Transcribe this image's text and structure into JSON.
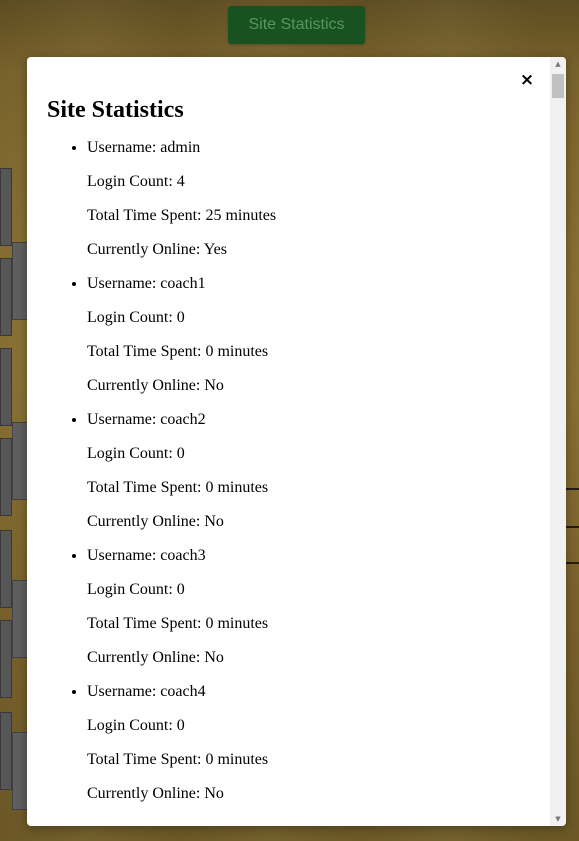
{
  "page": {
    "top_button_label": "Site Statistics"
  },
  "modal": {
    "title": "Site Statistics",
    "close_label": "×",
    "users": [
      {
        "username_line": "Username: admin",
        "login_count_line": "Login Count: 4",
        "time_spent_line": "Total Time Spent: 25 minutes",
        "online_line": "Currently Online: Yes"
      },
      {
        "username_line": "Username: coach1",
        "login_count_line": "Login Count: 0",
        "time_spent_line": "Total Time Spent: 0 minutes",
        "online_line": "Currently Online: No"
      },
      {
        "username_line": "Username: coach2",
        "login_count_line": "Login Count: 0",
        "time_spent_line": "Total Time Spent: 0 minutes",
        "online_line": "Currently Online: No"
      },
      {
        "username_line": "Username: coach3",
        "login_count_line": "Login Count: 0",
        "time_spent_line": "Total Time Spent: 0 minutes",
        "online_line": "Currently Online: No"
      },
      {
        "username_line": "Username: coach4",
        "login_count_line": "Login Count: 0",
        "time_spent_line": "Total Time Spent: 0 minutes",
        "online_line": "Currently Online: No"
      }
    ]
  },
  "scrollbar": {
    "up_arrow": "▲",
    "down_arrow": "▼"
  }
}
